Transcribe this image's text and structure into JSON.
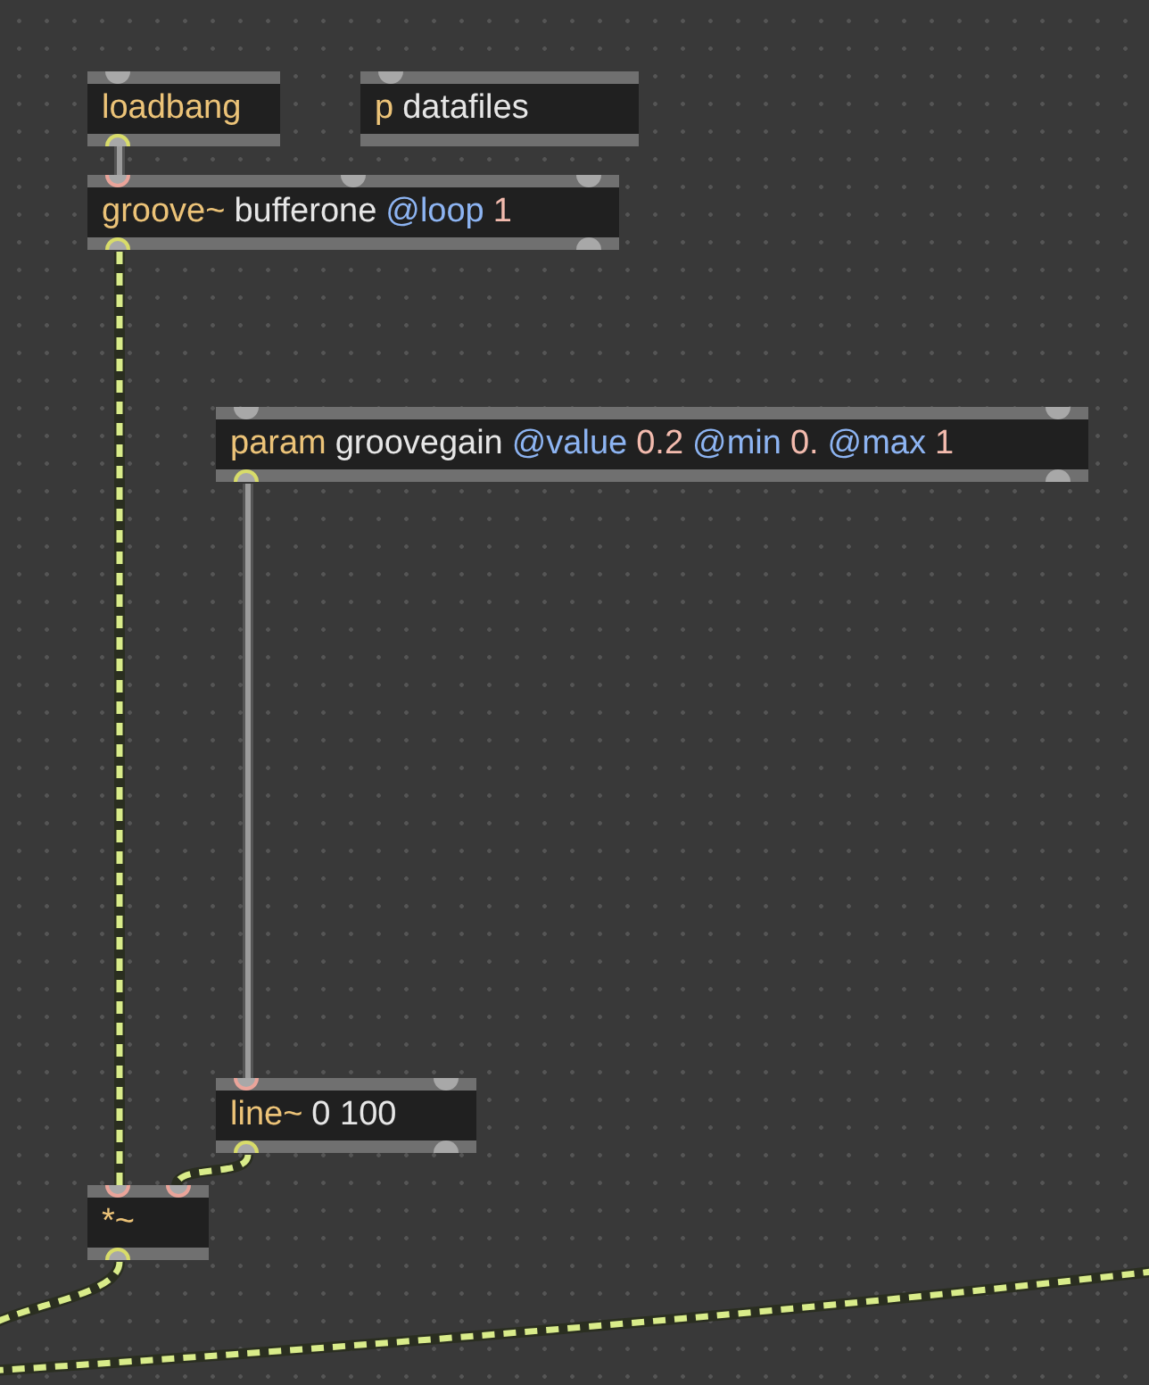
{
  "objects": [
    {
      "tokens": [
        {
          "kind": "class",
          "text": "loadbang"
        }
      ],
      "inlets": [
        {
          "connected": false
        }
      ],
      "outlets": [
        {
          "connected": true
        }
      ]
    },
    {
      "tokens": [
        {
          "kind": "class",
          "text": "p"
        },
        {
          "kind": "arg",
          "text": "datafiles"
        }
      ],
      "inlets": [
        {
          "connected": false
        }
      ]
    },
    {
      "tokens": [
        {
          "kind": "class",
          "text": "groove~"
        },
        {
          "kind": "arg",
          "text": "bufferone"
        },
        {
          "kind": "attr",
          "text": "@loop"
        },
        {
          "kind": "num",
          "text": "1"
        }
      ],
      "inlets": [
        {
          "connected": true
        },
        {
          "connected": false
        },
        {
          "connected": false
        }
      ],
      "outlets": [
        {
          "connected": true
        },
        {
          "connected": false
        }
      ]
    },
    {
      "tokens": [
        {
          "kind": "class",
          "text": "param"
        },
        {
          "kind": "arg",
          "text": "groovegain"
        },
        {
          "kind": "attr",
          "text": "@value"
        },
        {
          "kind": "num",
          "text": "0.2"
        },
        {
          "kind": "attr",
          "text": "@min"
        },
        {
          "kind": "num",
          "text": "0."
        },
        {
          "kind": "attr",
          "text": "@max"
        },
        {
          "kind": "num",
          "text": "1"
        }
      ],
      "inlets": [
        {
          "connected": false
        },
        {
          "connected": false
        }
      ],
      "outlets": [
        {
          "connected": true
        },
        {
          "connected": false
        }
      ]
    },
    {
      "tokens": [
        {
          "kind": "class",
          "text": "line~"
        },
        {
          "kind": "arg",
          "text": "0 100"
        }
      ],
      "inlets": [
        {
          "connected": true
        },
        {
          "connected": false
        }
      ],
      "outlets": [
        {
          "connected": true
        },
        {
          "connected": false
        }
      ]
    },
    {
      "tokens": [
        {
          "kind": "class",
          "text": "*~"
        }
      ],
      "inlets": [
        {
          "connected": true
        },
        {
          "connected": true
        }
      ],
      "outlets": [
        {
          "connected": true
        }
      ]
    }
  ],
  "cords": [
    {
      "kind": "control"
    },
    {
      "kind": "signal"
    },
    {
      "kind": "control"
    },
    {
      "kind": "signal"
    },
    {
      "kind": "signal"
    },
    {
      "kind": "signal"
    }
  ]
}
